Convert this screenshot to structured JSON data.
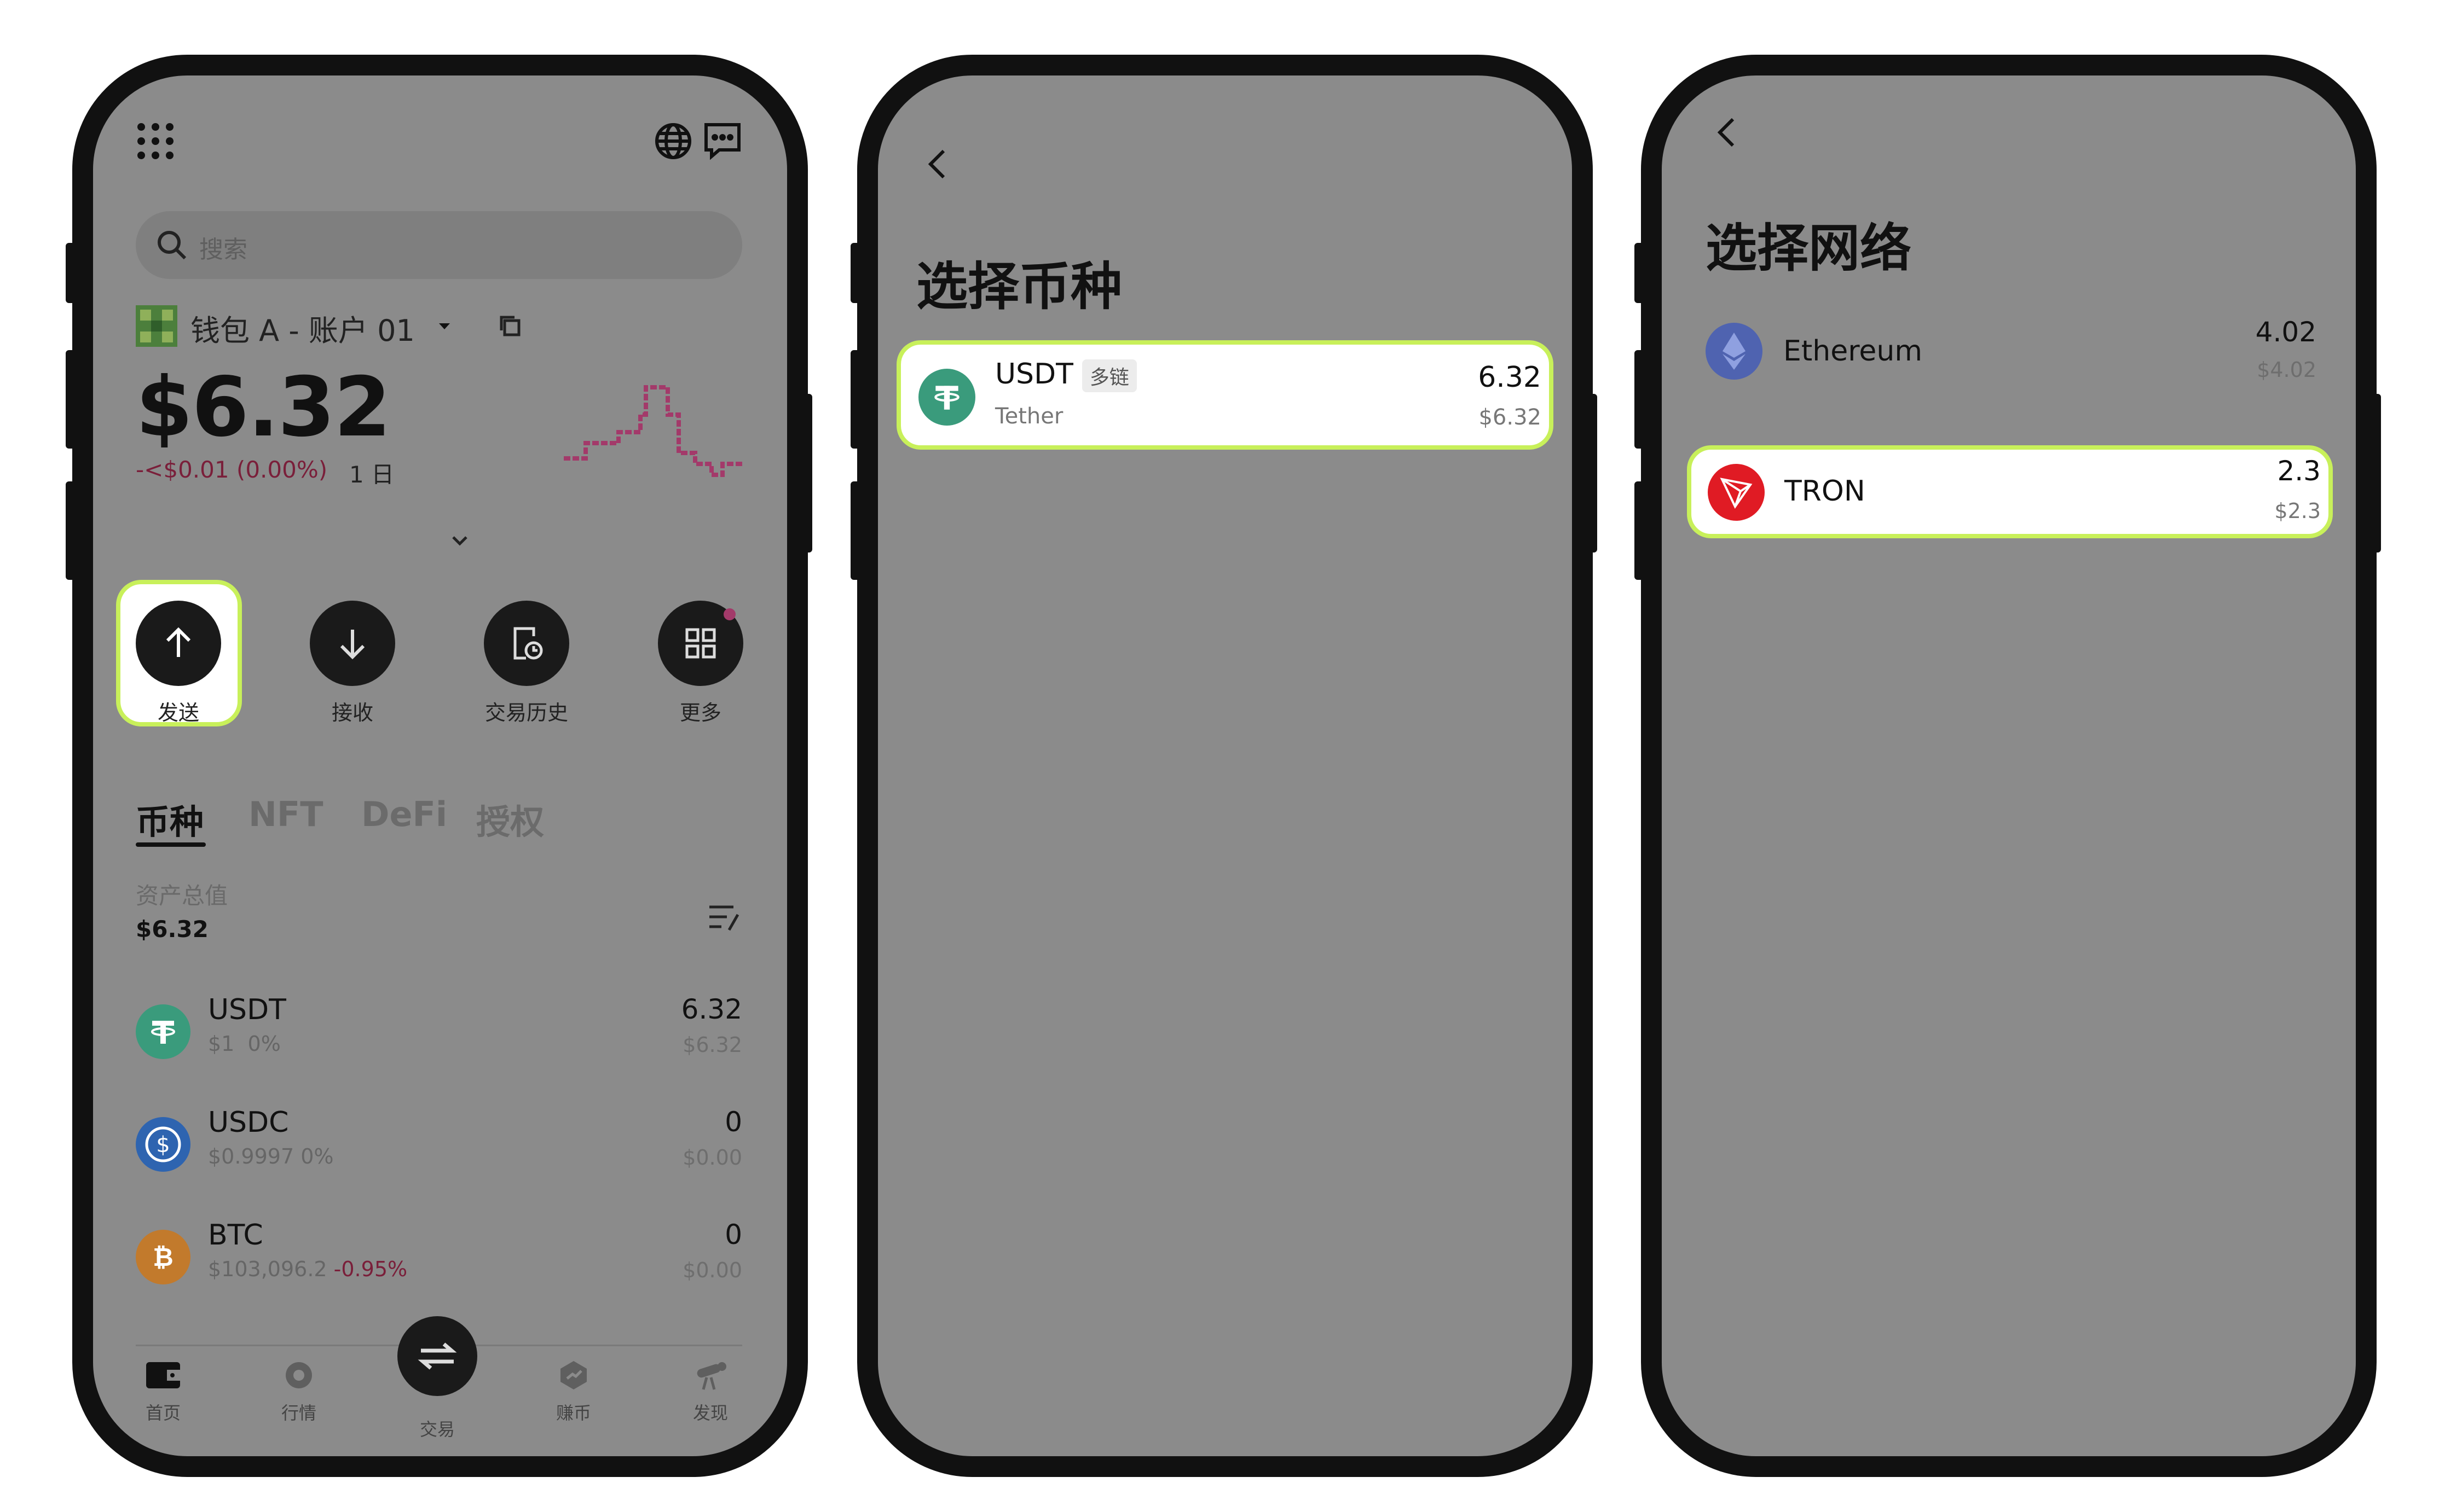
{
  "phone1": {
    "search": {
      "placeholder": "搜索"
    },
    "wallet": {
      "name": "钱包 A - 账户 01"
    },
    "balance": "$6.32",
    "change": "-<$0.01 (0.00%)",
    "period": "1 日",
    "actions": [
      {
        "label": "发送",
        "icon": "arrow-up-icon"
      },
      {
        "label": "接收",
        "icon": "arrow-down-icon"
      },
      {
        "label": "交易历史",
        "icon": "history-icon"
      },
      {
        "label": "更多",
        "icon": "grid-icon"
      }
    ],
    "tabs": [
      "币种",
      "NFT",
      "DeFi",
      "授权"
    ],
    "assets": {
      "label": "资产总值",
      "value": "$6.32"
    },
    "coins": [
      {
        "name": "USDT",
        "price": "$1",
        "change": "0%",
        "amount": "6.32",
        "usd": "$6.32",
        "color": "#3a9b7c"
      },
      {
        "name": "USDC",
        "price": "$0.9997",
        "change": "0%",
        "amount": "0",
        "usd": "$0.00",
        "color": "#2e64b0"
      },
      {
        "name": "BTC",
        "price": "$103,096.2",
        "change": "-0.95%",
        "amount": "0",
        "usd": "$0.00",
        "color": "#c27a2c"
      }
    ],
    "nav": [
      {
        "label": "首页",
        "icon": "wallet-icon"
      },
      {
        "label": "行情",
        "icon": "market-icon"
      },
      {
        "label": "交易",
        "icon": "swap-icon"
      },
      {
        "label": "赚币",
        "icon": "earn-icon"
      },
      {
        "label": "发现",
        "icon": "discover-icon"
      }
    ]
  },
  "phone2": {
    "title": "选择币种",
    "item": {
      "name": "USDT",
      "tag": "多链",
      "sub": "Tether",
      "amount": "6.32",
      "usd": "$6.32"
    }
  },
  "phone3": {
    "title": "选择网络",
    "networks": [
      {
        "name": "Ethereum",
        "amount": "4.02",
        "usd": "$4.02",
        "color": "#4f63b0"
      },
      {
        "name": "TRON",
        "amount": "2.3",
        "usd": "$2.3",
        "color": "#e01b24"
      }
    ]
  },
  "colors": {
    "highlight": "#c8f05a",
    "overlay": "#8b8b8b",
    "negative": "#7a1f3a"
  }
}
